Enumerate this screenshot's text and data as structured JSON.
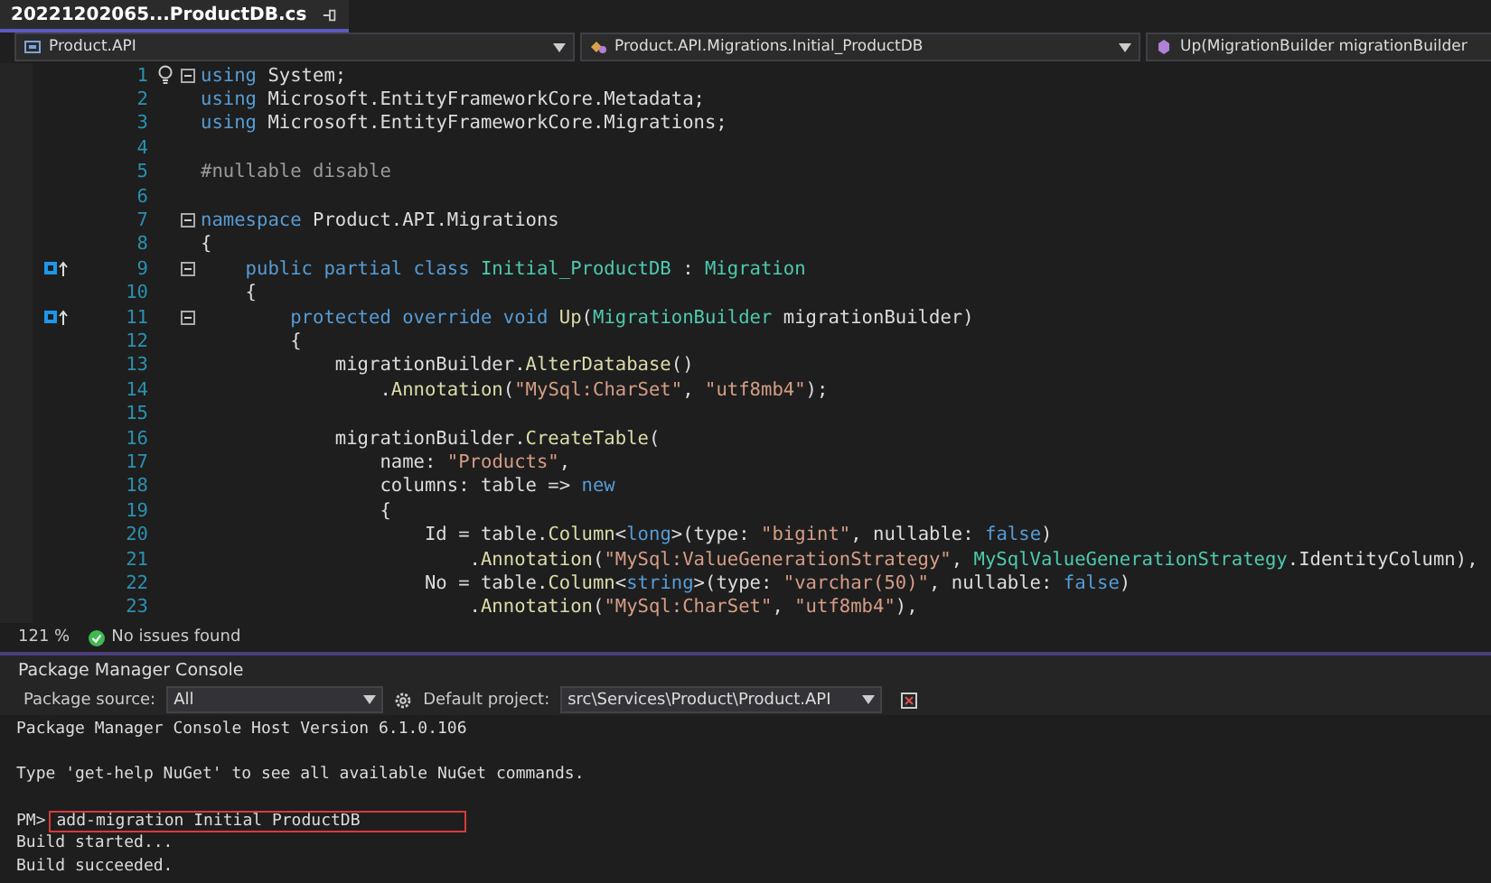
{
  "tab": {
    "title": "20221202065...ProductDB.cs",
    "selected": true
  },
  "nav": {
    "project": "Product.API",
    "class": "Product.API.Migrations.Initial_ProductDB",
    "member": "Up(MigrationBuilder migrationBuilder"
  },
  "code": {
    "lines": [
      {
        "number": "1",
        "fold": true,
        "lightbulb": true,
        "tokens": [
          {
            "kind": "kw",
            "text": "using"
          },
          {
            "kind": "plain",
            "text": " System;"
          }
        ]
      },
      {
        "number": "2",
        "tokens": [
          {
            "kind": "kw",
            "text": "using"
          },
          {
            "kind": "plain",
            "text": " Microsoft.EntityFrameworkCore.Metadata;"
          }
        ]
      },
      {
        "number": "3",
        "tokens": [
          {
            "kind": "kw",
            "text": "using"
          },
          {
            "kind": "plain",
            "text": " Microsoft.EntityFrameworkCore.Migrations;"
          }
        ]
      },
      {
        "number": "4"
      },
      {
        "number": "5",
        "tokens": [
          {
            "kind": "pre",
            "text": "#nullable disable"
          }
        ]
      },
      {
        "number": "6"
      },
      {
        "number": "7",
        "fold": true,
        "tokens": [
          {
            "kind": "kw",
            "text": "namespace"
          },
          {
            "kind": "plain",
            "text": " Product.API.Migrations"
          }
        ]
      },
      {
        "number": "8",
        "tokens": [
          {
            "kind": "plain",
            "text": "{"
          }
        ]
      },
      {
        "number": "9",
        "fold": true,
        "marker": true,
        "tokens": [
          {
            "kind": "kw",
            "text": "    public partial class "
          },
          {
            "kind": "type",
            "text": "Initial_ProductDB"
          },
          {
            "kind": "plain",
            "text": " : "
          },
          {
            "kind": "type",
            "text": "Migration"
          }
        ]
      },
      {
        "number": "10",
        "tokens": [
          {
            "kind": "plain",
            "text": "    {"
          }
        ]
      },
      {
        "number": "11",
        "fold": true,
        "marker": true,
        "tokens": [
          {
            "kind": "kw",
            "text": "        protected override void "
          },
          {
            "kind": "method",
            "text": "Up"
          },
          {
            "kind": "plain",
            "text": "("
          },
          {
            "kind": "type",
            "text": "MigrationBuilder"
          },
          {
            "kind": "plain",
            "text": " migrationBuilder)"
          }
        ]
      },
      {
        "number": "12",
        "tokens": [
          {
            "kind": "plain",
            "text": "        {"
          }
        ]
      },
      {
        "number": "13",
        "tokens": [
          {
            "kind": "plain",
            "text": "            migrationBuilder."
          },
          {
            "kind": "method",
            "text": "AlterDatabase"
          },
          {
            "kind": "plain",
            "text": "()"
          }
        ]
      },
      {
        "number": "14",
        "tokens": [
          {
            "kind": "plain",
            "text": "                ."
          },
          {
            "kind": "method",
            "text": "Annotation"
          },
          {
            "kind": "plain",
            "text": "("
          },
          {
            "kind": "str",
            "text": "\"MySql:CharSet\""
          },
          {
            "kind": "plain",
            "text": ", "
          },
          {
            "kind": "str",
            "text": "\"utf8mb4\""
          },
          {
            "kind": "plain",
            "text": ");"
          }
        ]
      },
      {
        "number": "15"
      },
      {
        "number": "16",
        "tokens": [
          {
            "kind": "plain",
            "text": "            migrationBuilder."
          },
          {
            "kind": "method",
            "text": "CreateTable"
          },
          {
            "kind": "plain",
            "text": "("
          }
        ]
      },
      {
        "number": "17",
        "tokens": [
          {
            "kind": "plain",
            "text": "                name: "
          },
          {
            "kind": "str",
            "text": "\"Products\""
          },
          {
            "kind": "plain",
            "text": ","
          }
        ]
      },
      {
        "number": "18",
        "tokens": [
          {
            "kind": "plain",
            "text": "                columns: table => "
          },
          {
            "kind": "kw",
            "text": "new"
          }
        ]
      },
      {
        "number": "19",
        "tokens": [
          {
            "kind": "plain",
            "text": "                {"
          }
        ]
      },
      {
        "number": "20",
        "tokens": [
          {
            "kind": "plain",
            "text": "                    Id = table."
          },
          {
            "kind": "method",
            "text": "Column"
          },
          {
            "kind": "plain",
            "text": "<"
          },
          {
            "kind": "kw",
            "text": "long"
          },
          {
            "kind": "plain",
            "text": ">(type: "
          },
          {
            "kind": "str",
            "text": "\"bigint\""
          },
          {
            "kind": "plain",
            "text": ", nullable: "
          },
          {
            "kind": "kw",
            "text": "false"
          },
          {
            "kind": "plain",
            "text": ")"
          }
        ]
      },
      {
        "number": "21",
        "tokens": [
          {
            "kind": "plain",
            "text": "                        ."
          },
          {
            "kind": "method",
            "text": "Annotation"
          },
          {
            "kind": "plain",
            "text": "("
          },
          {
            "kind": "str",
            "text": "\"MySql:ValueGenerationStrategy\""
          },
          {
            "kind": "plain",
            "text": ", "
          },
          {
            "kind": "type",
            "text": "MySqlValueGenerationStrategy"
          },
          {
            "kind": "plain",
            "text": ".IdentityColumn),"
          }
        ]
      },
      {
        "number": "22",
        "tokens": [
          {
            "kind": "plain",
            "text": "                    No = table."
          },
          {
            "kind": "method",
            "text": "Column"
          },
          {
            "kind": "plain",
            "text": "<"
          },
          {
            "kind": "kw",
            "text": "string"
          },
          {
            "kind": "plain",
            "text": ">(type: "
          },
          {
            "kind": "str",
            "text": "\"varchar(50)\""
          },
          {
            "kind": "plain",
            "text": ", nullable: "
          },
          {
            "kind": "kw",
            "text": "false"
          },
          {
            "kind": "plain",
            "text": ")"
          }
        ]
      },
      {
        "number": "23",
        "tokens": [
          {
            "kind": "plain",
            "text": "                        ."
          },
          {
            "kind": "method",
            "text": "Annotation"
          },
          {
            "kind": "plain",
            "text": "("
          },
          {
            "kind": "str",
            "text": "\"MySql:CharSet\""
          },
          {
            "kind": "plain",
            "text": ", "
          },
          {
            "kind": "str",
            "text": "\"utf8mb4\""
          },
          {
            "kind": "plain",
            "text": "),"
          }
        ]
      }
    ]
  },
  "status_bar": {
    "zoom": "121 %",
    "issues": "No issues found"
  },
  "console": {
    "title": "Package Manager Console",
    "source_label": "Package source:",
    "source": "All",
    "project_label": "Default project:",
    "project": "src\\Services\\Product\\Product.API",
    "output": [
      {
        "kind": "text",
        "text": "Package Manager Console Host Version 6.1.0.106"
      },
      {
        "kind": "blank"
      },
      {
        "kind": "text",
        "text": "Type 'get-help NuGet' to see all available NuGet commands."
      },
      {
        "kind": "blank"
      },
      {
        "kind": "prompt",
        "prompt": "PM>",
        "command": "add-migration Initial ProductDB",
        "highlighted": true
      },
      {
        "kind": "text",
        "text": "Build started..."
      },
      {
        "kind": "text",
        "text": "Build succeeded."
      }
    ]
  }
}
